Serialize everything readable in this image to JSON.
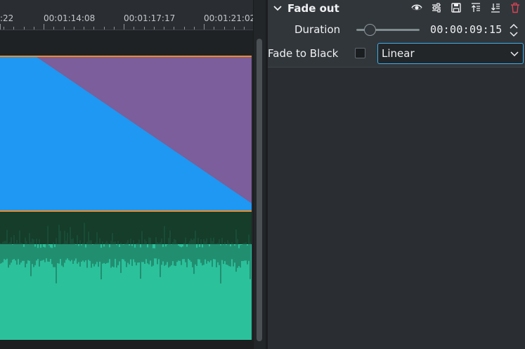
{
  "timeline": {
    "ruler_labels": [
      ":22",
      "00:01:14:08",
      "00:01:17:17",
      "00:01:21:02"
    ],
    "video_clip_color": "#1e98f2",
    "fade_overlay_color": "#7b5e9b",
    "clip_border_color": "#f28a22",
    "audio_wave_color": "#2bc19b",
    "audio_bg_color": "#153d2a"
  },
  "effect": {
    "title": "Fade out",
    "header_icons": [
      "eye-icon",
      "sliders-icon",
      "save-icon",
      "move-up-icon",
      "move-down-icon",
      "delete-icon"
    ],
    "duration_label": "Duration",
    "duration_value": "00:00:09:15",
    "fade_to_black_label": "Fade to Black",
    "fade_to_black_checked": false,
    "curve_selected": "Linear"
  },
  "colors": {
    "accent": "#3daee9",
    "delete": "#da4453"
  }
}
